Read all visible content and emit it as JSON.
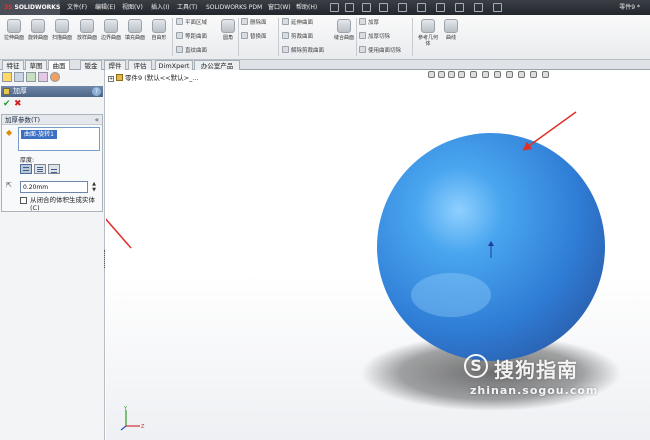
{
  "app": {
    "logo": "SOLIDWORKS",
    "menu": [
      "文件(F)",
      "编辑(E)",
      "视图(V)",
      "插入(I)",
      "工具(T)",
      "SOLIDWORKS PDM",
      "窗口(W)",
      "帮助(H)"
    ],
    "document_title": "零件9 *"
  },
  "ribbon": {
    "big_buttons": [
      "拉伸曲面",
      "旋转曲面",
      "扫描曲面",
      "放样曲面",
      "边界曲面",
      "填充曲面",
      "自由形"
    ],
    "col1": [
      "平面区域",
      "等距曲面",
      "直纹曲面"
    ],
    "fillet": "圆角",
    "col2": [
      "删除面",
      "替换面"
    ],
    "col3": [
      "延伸曲面",
      "剪裁曲面",
      "解除剪裁曲面"
    ],
    "knit": "缝合曲面",
    "col4": [
      "加厚",
      "加厚切除",
      "使用曲面切除"
    ],
    "ref_geometry": "参考几何体",
    "curves": "曲线"
  },
  "tabs": [
    "特征",
    "草图",
    "曲面",
    "钣金",
    "焊件",
    "评估",
    "DimXpert",
    "办公室产品"
  ],
  "active_tab": "曲面",
  "property_manager": {
    "title": "加厚",
    "help": "?",
    "ok": "✔",
    "cancel": "✖",
    "group_title": "加厚参数(T)",
    "collapse": "«",
    "face": "曲面-旋转1",
    "thickness_label": "厚度:",
    "thickness_value": "0.20mm",
    "create_solid_label": "从闭合的体积生成实体(C)",
    "create_solid_checked": false
  },
  "feature_tree": {
    "item": "零件9 (默认<<默认>_..."
  },
  "watermark": {
    "name": "搜狗指南",
    "url": "zhinan.sogou.com"
  },
  "colors": {
    "sphere": "#3b8fe0",
    "arrow": "#e0302c",
    "selection": "#3b6fc3"
  },
  "icons": {
    "ok": "check-icon",
    "cancel": "close-icon",
    "thicken": "thicken-icon"
  }
}
